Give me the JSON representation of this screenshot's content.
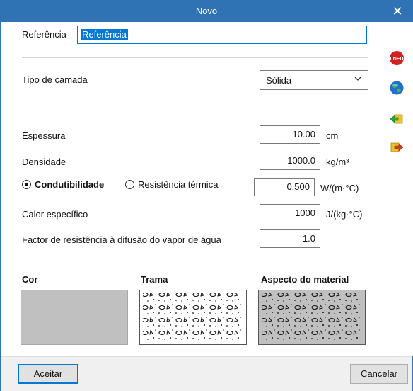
{
  "window": {
    "title": "Novo",
    "close_glyph": "✕"
  },
  "referencia": {
    "label": "Referência",
    "value": "Referência"
  },
  "tipo_de_camada": {
    "label": "Tipo de camada",
    "selected": "Sólida"
  },
  "espessura": {
    "label": "Espessura",
    "value": "10.00",
    "unit": "cm"
  },
  "densidade": {
    "label": "Densidade",
    "value": "1000.0",
    "unit": "kg/m³"
  },
  "condutividade": {
    "option_a": "Condutibilidade",
    "option_b": "Resistência térmica",
    "selected": "Condutibilidade",
    "value": "0.500",
    "unit": "W/(m·°C)"
  },
  "calor": {
    "label": "Calor específico",
    "value": "1000",
    "unit": "J/(kg·°C)"
  },
  "factor": {
    "label": "Factor de resistência à difusão do vapor de água",
    "value": "1.0"
  },
  "appearance": {
    "cor_label": "Cor",
    "trama_label": "Trama",
    "aspecto_label": "Aspecto do material",
    "cor_color": "#c0c0c0"
  },
  "sidebar": {
    "icons": [
      "lned-icon",
      "globe-icon",
      "import-arrow-icon",
      "export-arrow-icon"
    ],
    "lned_text": "LNED"
  },
  "buttons": {
    "accept": "Aceitar",
    "cancel": "Cancelar"
  },
  "colors": {
    "titlebar": "#2f73b5",
    "selection": "#0078d7"
  }
}
